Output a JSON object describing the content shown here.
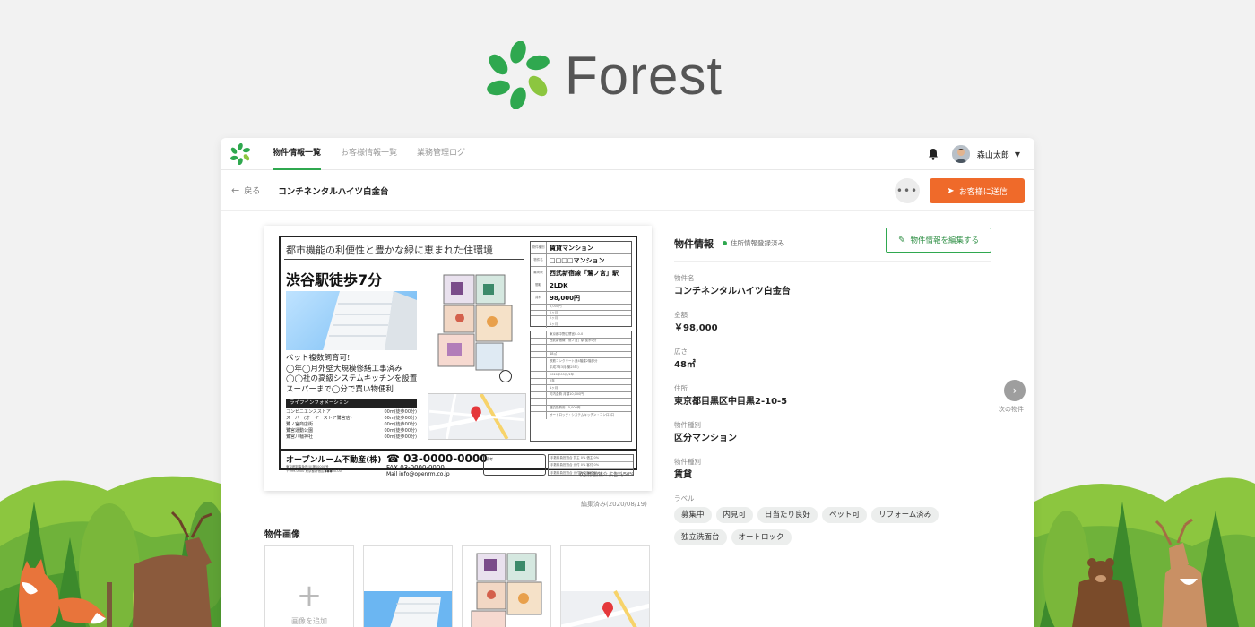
{
  "brand": {
    "name": "Forest",
    "logo_icon": "leaf-wreath-icon",
    "color": "#2fa84f"
  },
  "nav": {
    "tabs": [
      "物件情報一覧",
      "お客様情報一覧",
      "業務管理ログ"
    ],
    "active_tab": 0,
    "user_name": "森山太郎"
  },
  "subbar": {
    "back_label": "戻る",
    "property_name": "コンチネンタルハイツ白金台",
    "more_label": "•••",
    "send_label": "お客様に送信",
    "send_color": "#ef6a2a"
  },
  "flyer": {
    "catch": "都市機能の利便性と豊かな緑に恵まれた住環境",
    "station": "渋谷駅徒歩7分",
    "features": "ペット複数飼育可!\n◯年◯月外壁大規模修繕工事済み\n◯◯社の高級システムキッチンを設置\nスーパーまで◯分で買い物便利",
    "life_info_title": "ライフインフォメーション",
    "life_info": [
      {
        "name": "コンビニエンスストア",
        "dist": "00m(徒歩00分)"
      },
      {
        "name": "スーパー(オーケーストア鷺宮店)",
        "dist": "00m(徒歩00分)"
      },
      {
        "name": "鷺ノ宮商店街",
        "dist": "00m(徒歩00分)"
      },
      {
        "name": "鷺宮運動公園",
        "dist": "00m(徒歩00分)"
      },
      {
        "name": "鷺宮八幡神社",
        "dist": "00m(徒歩00分)"
      }
    ],
    "table_main": [
      {
        "k": "物件種別",
        "v": "賃貸マンション"
      },
      {
        "k": "物件名",
        "v": "□□□□マンション"
      },
      {
        "k": "最寄駅",
        "v": "西武新宿線「鷺ノ宮」駅"
      },
      {
        "k": "間取",
        "v": "2LDK"
      },
      {
        "k": "賃料",
        "v": "98,000円"
      }
    ],
    "table_main_small": [
      "5,000円",
      "2ヶ月",
      "2ヶ月",
      "1ヶ月"
    ],
    "table_detail": [
      "東京都中野区鷺宮0-0-0",
      "西武新宿線「鷺ノ宮」駅 徒歩0分",
      "",
      "48㎡",
      "鉄筋コンクリート造4階建2階部分",
      "平成7年3月(築25年)",
      "2020年05月/2年",
      "2年",
      "1ヶ月",
      "町内会費 月額10,000円",
      "",
      "鍵交換費用 15,000円",
      "オートロック・システムキッチン・コンロ3口"
    ],
    "agency": "オープンルーム不動産(株)",
    "agency_sub": "東京都知事免許(0)第00000号\n〒999-0000 東京都新宿区●●●00-00",
    "tel": "03-0000-0000",
    "fax": "03-0000-0000",
    "mail": "info@openrm.co.jp",
    "remarks_label": "備考",
    "fee_rows": [
      "手数料負担割合  貸主 0%  借主 0%",
      "手数料負担割合  元付 0%  客付 0%",
      "手数料負担割合  元付 0%  客付 0%"
    ],
    "footnote": "取引形態/媒介 広告料/50%"
  },
  "edited_label": "編集済み(2020/08/19)",
  "images": {
    "title": "物件画像",
    "add_label": "画像を追加"
  },
  "info": {
    "title": "物件情報",
    "status": "住所情報登録済み",
    "status_color": "#2fa84f",
    "edit_label": "物件情報を編集する",
    "fields": [
      {
        "label": "物件名",
        "value": "コンチネンタルハイツ白金台"
      },
      {
        "label": "金額",
        "value": "￥98,000"
      },
      {
        "label": "広さ",
        "value": "48㎡"
      },
      {
        "label": "住所",
        "value": "東京都目黒区中目黒2-10-5"
      },
      {
        "label": "物件種別",
        "value": "区分マンション"
      },
      {
        "label": "物件種別",
        "value": "賃貸"
      }
    ],
    "labels_title": "ラベル",
    "labels": [
      "募集中",
      "内見可",
      "日当たり良好",
      "ペット可",
      "リフォーム済み",
      "独立洗面台",
      "オートロック"
    ]
  },
  "next": {
    "icon": "chevron-right-icon",
    "label": "次の物件"
  }
}
